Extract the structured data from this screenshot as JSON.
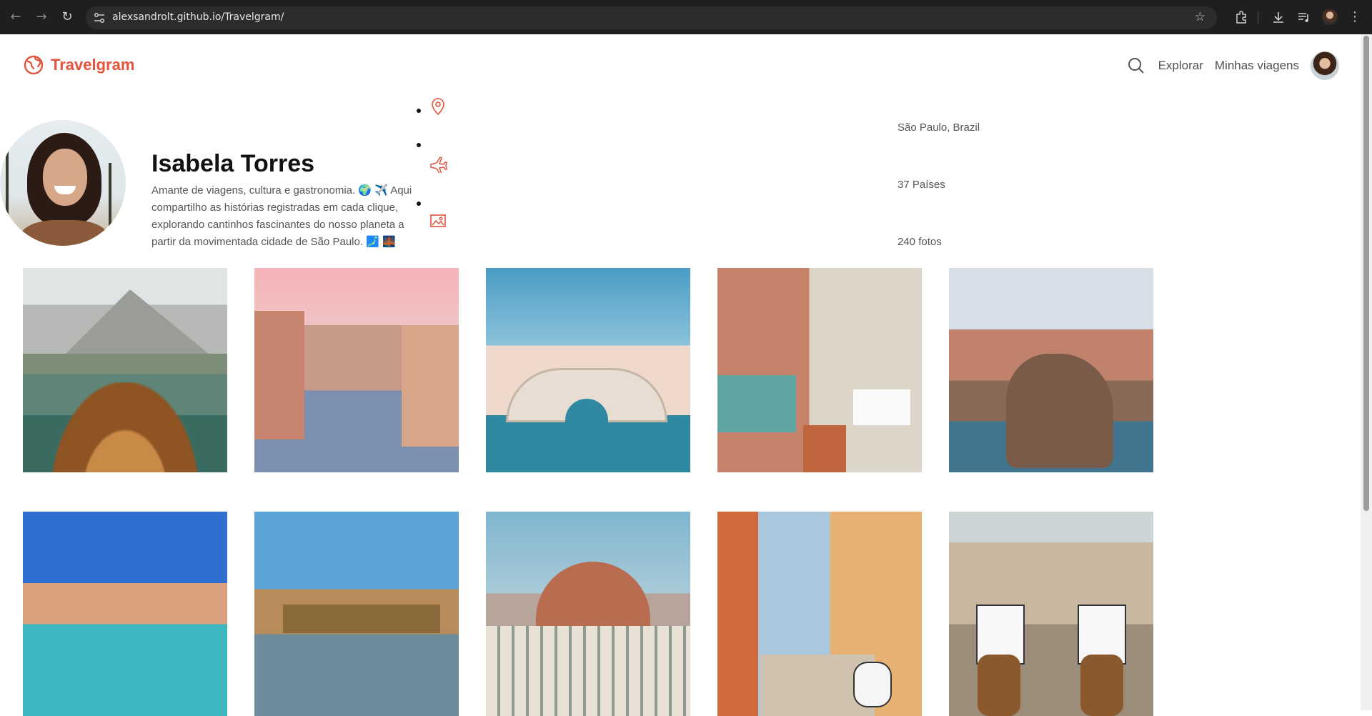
{
  "browser": {
    "url": "alexsandrolt.github.io/Travelgram/"
  },
  "site": {
    "brand": "Travelgram",
    "nav": [
      {
        "label": "Explorar"
      },
      {
        "label": "Minhas viagens"
      }
    ]
  },
  "profile": {
    "name": "Isabela Torres",
    "bio": "Amante de viagens, cultura e gastronomia. 🌍 ✈️ Aqui compartilho as histórias registradas em cada clique, explorando cantinhos fascinantes do nosso planeta a partir da movimentada cidade de São Paulo. 🗾 🌉",
    "stats": [
      {
        "icon": "map-pin-icon",
        "text": "São Paulo, Brazil"
      },
      {
        "icon": "airplane-icon",
        "text": "37 Países"
      },
      {
        "icon": "image-icon",
        "text": "240 fotos"
      }
    ]
  },
  "colors": {
    "accent": "#e5533d",
    "chrome_bg": "#1f1f1f"
  },
  "gallery_count": 10
}
